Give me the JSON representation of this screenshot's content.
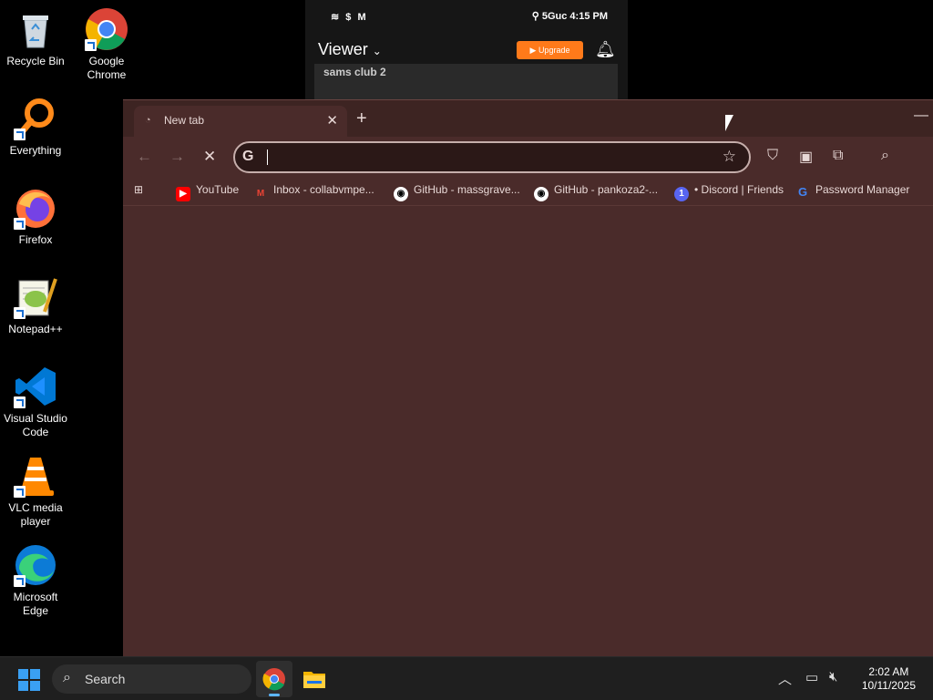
{
  "desktop": {
    "icons": [
      {
        "label": "Recycle Bin",
        "icon": "recycle-bin-icon"
      },
      {
        "label": "Google Chrome",
        "icon": "chrome-icon"
      },
      {
        "label": "Everything",
        "icon": "everything-search-icon"
      },
      {
        "label": "Firefox",
        "icon": "firefox-icon"
      },
      {
        "label": "Notepad++",
        "icon": "notepadpp-icon"
      },
      {
        "label": "Visual Studio Code",
        "icon": "vscode-icon"
      },
      {
        "label": "VLC media player",
        "icon": "vlc-icon"
      },
      {
        "label": "Microsoft Edge",
        "icon": "edge-icon"
      }
    ]
  },
  "phone": {
    "status_left": "$ M",
    "status_right": "5Guc 4:15 PM",
    "viewer_label": "Viewer",
    "upgrade_label": "▶ Upgrade",
    "sub_title": "sams club 2"
  },
  "browser": {
    "tab_title": "New tab",
    "omnibox_value": "",
    "bookmarks": [
      {
        "label": "YouTube",
        "color": "#ff0000"
      },
      {
        "label": "Inbox - collabvmpe...",
        "color": "#ea4335"
      },
      {
        "label": "GitHub - massgrave...",
        "color": "#ffffff"
      },
      {
        "label": "GitHub - pankoza2-...",
        "color": "#ffffff"
      },
      {
        "label": "• Discord | Friends",
        "color": "#5865f2"
      },
      {
        "label": "Password Manager",
        "color": "#4285f4"
      }
    ]
  },
  "taskbar": {
    "search_label": "Search",
    "time": "2:02 AM",
    "date": "10/11/2025"
  },
  "colors": {
    "window_bg": "#4a2b2a",
    "tabbar_bg": "#3d2422",
    "accent": "#5cb6ff"
  }
}
